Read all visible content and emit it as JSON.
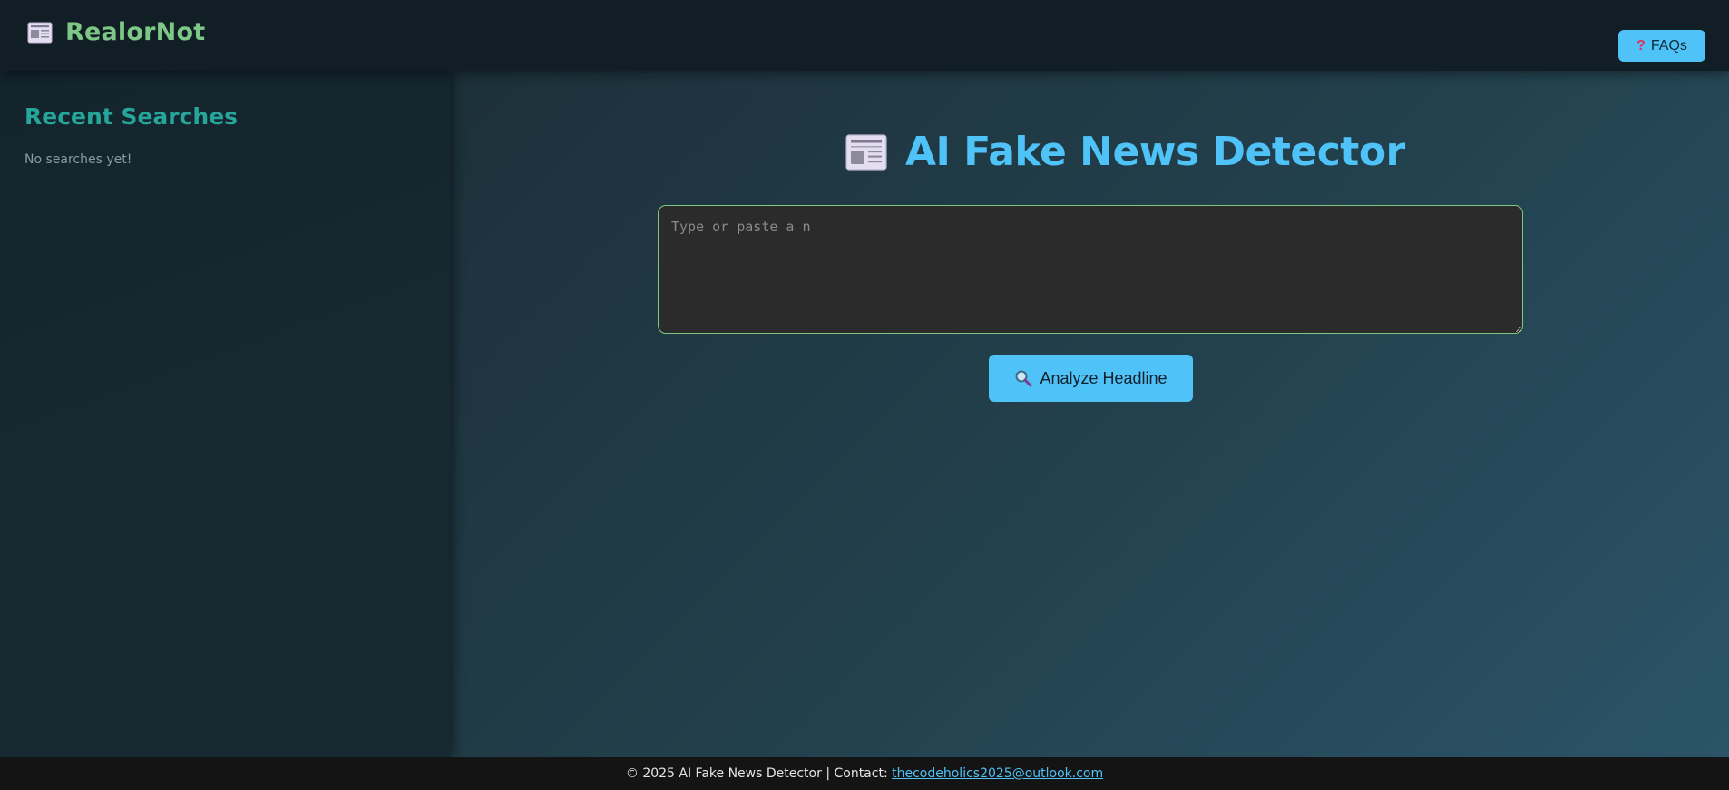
{
  "header": {
    "logo_icon": "newspaper-icon",
    "brand_name": "RealorNot",
    "faq_icon": "question-mark-icon",
    "faq_label": "FAQs"
  },
  "sidebar": {
    "title": "Recent Searches",
    "empty_text": "No searches yet!"
  },
  "main": {
    "heading_icon": "newspaper-icon",
    "heading": "AI Fake News Detector",
    "input_placeholder": "Type or paste a n",
    "input_value": "",
    "analyze_icon": "magnifier-icon",
    "analyze_label": "Analyze Headline"
  },
  "footer": {
    "text": "© 2025 AI Fake News Detector | Contact:",
    "email": "thecodeholics2025@outlook.com"
  },
  "colors": {
    "accent_blue": "#4fc3f7",
    "brand_green": "#7dc887",
    "sidebar_teal": "#26a69a",
    "input_border": "#7fc77e"
  }
}
